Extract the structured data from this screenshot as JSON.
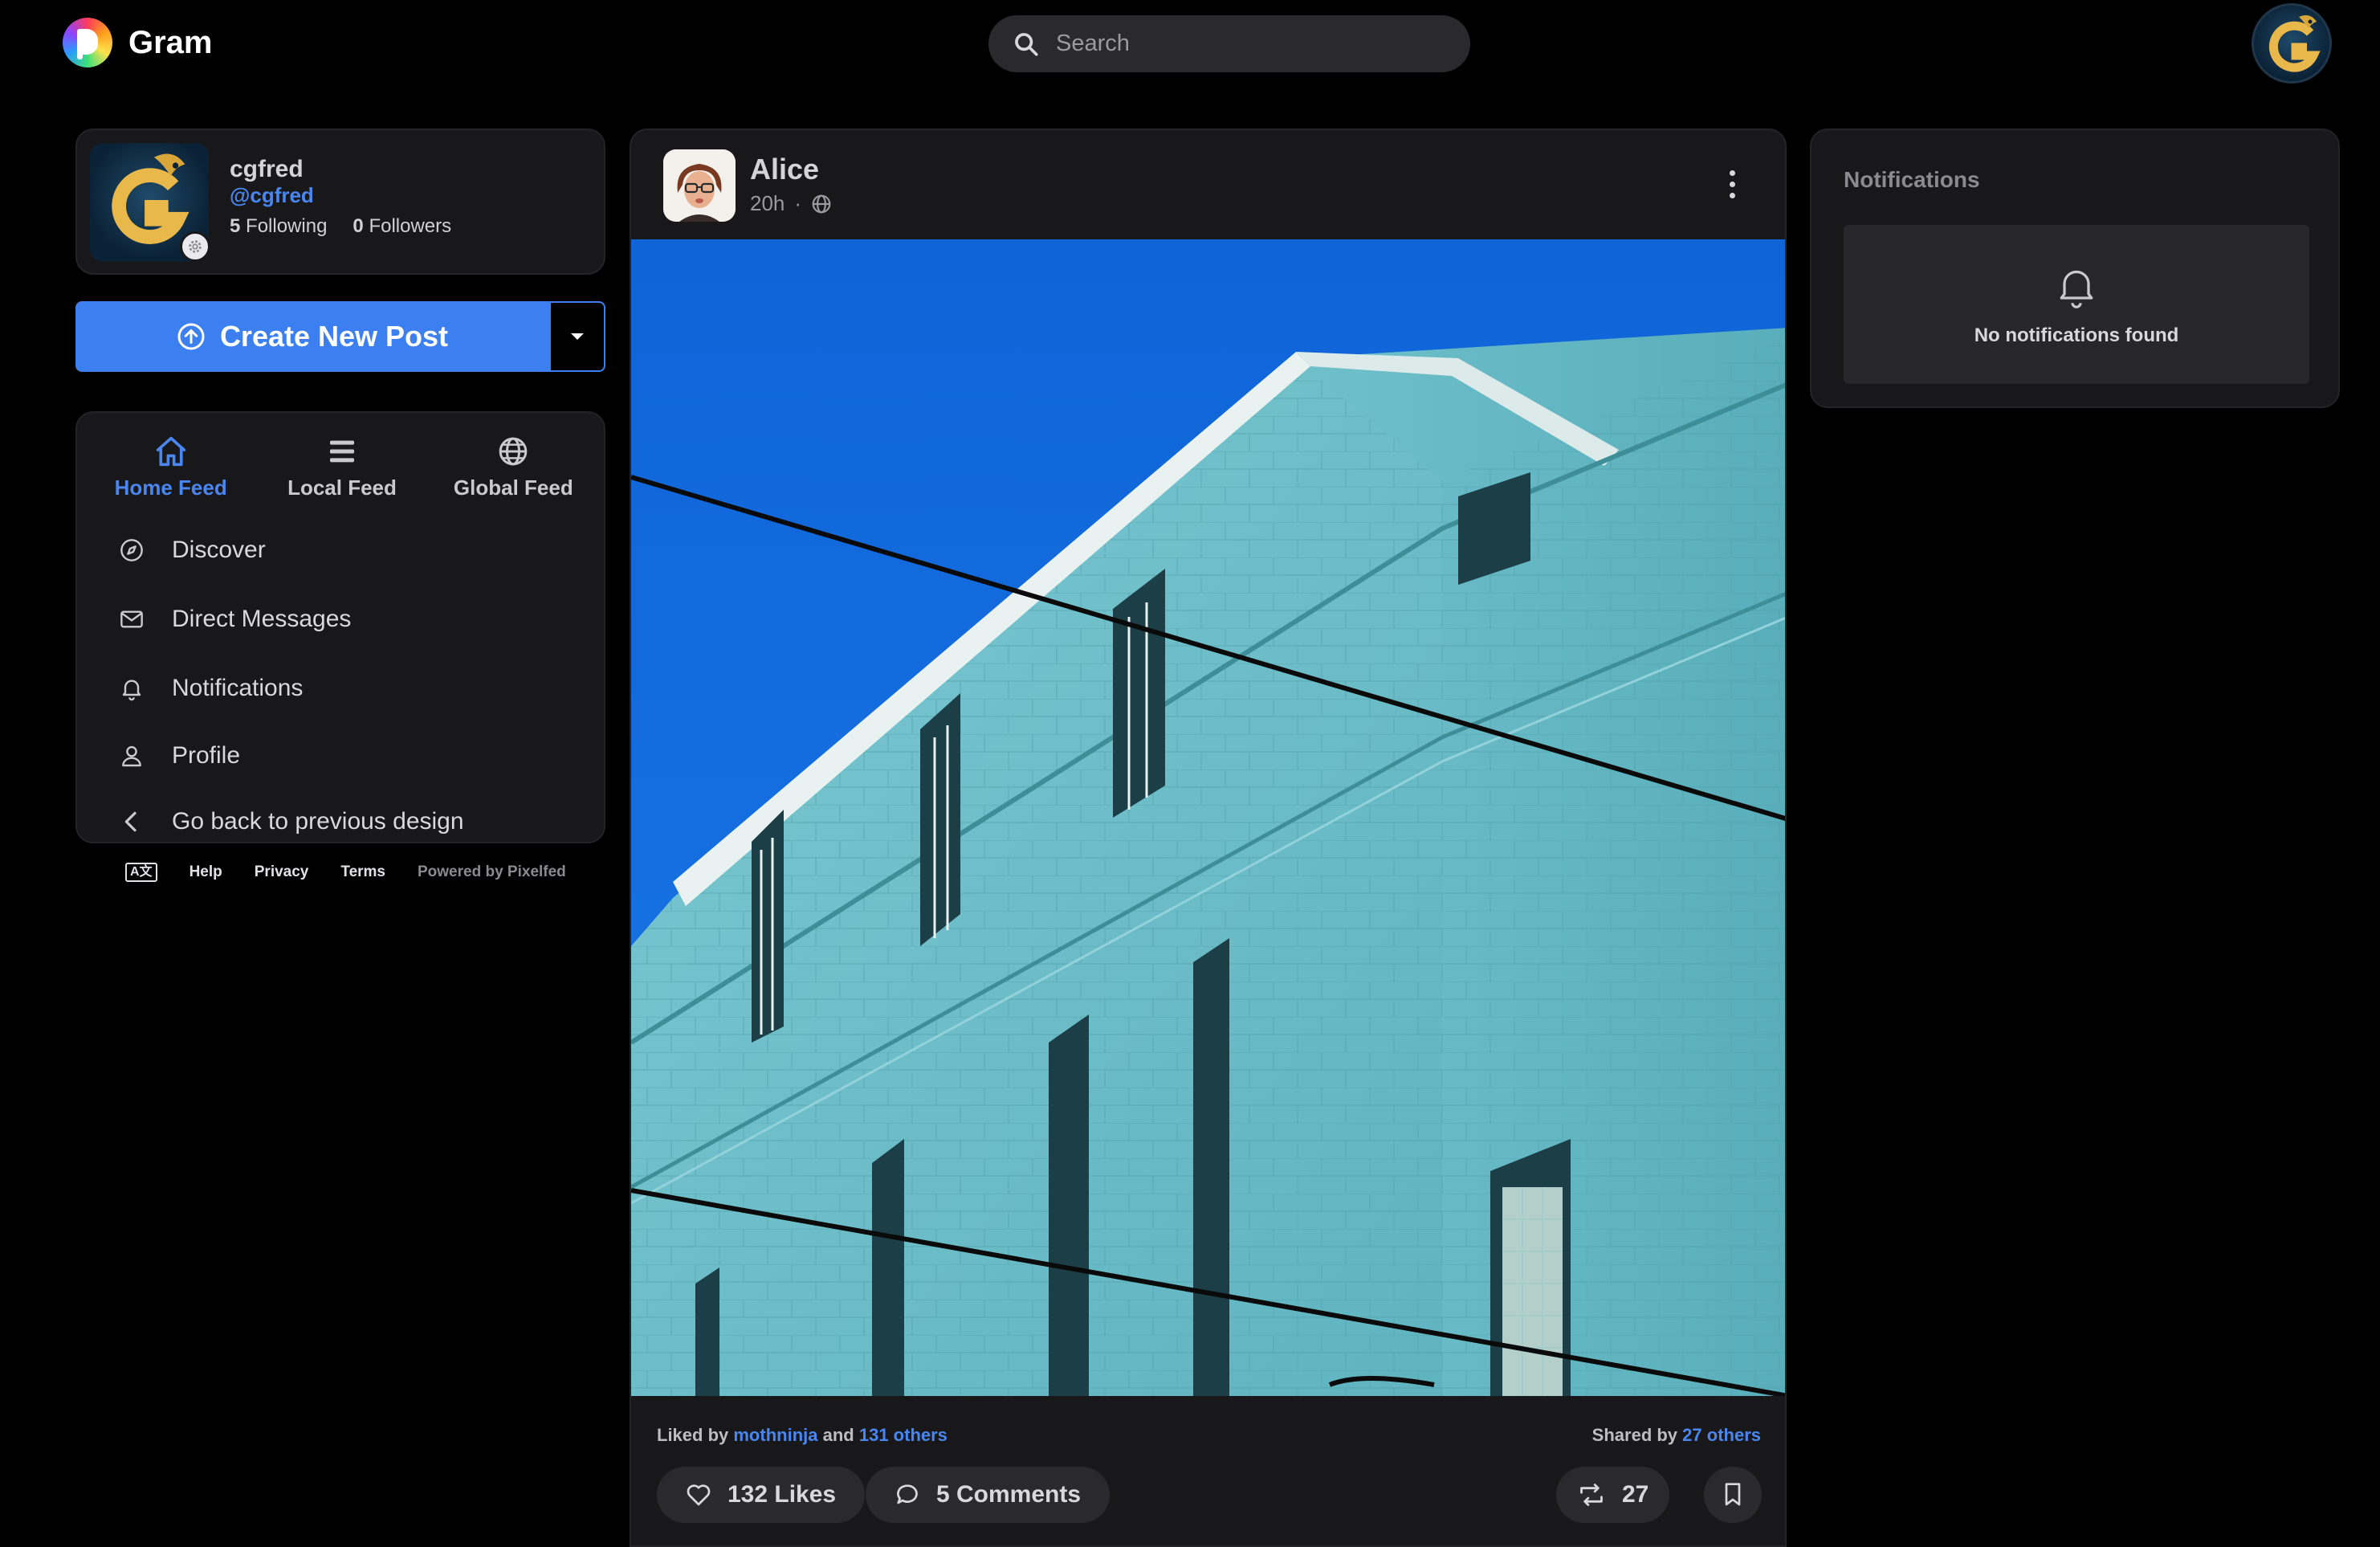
{
  "brand": {
    "name": "Gram"
  },
  "search": {
    "placeholder": "Search"
  },
  "profile": {
    "name": "cgfred",
    "handle": "@cgfred",
    "following_count": "5",
    "following_label": "Following",
    "followers_count": "0",
    "followers_label": "Followers"
  },
  "create_post": {
    "label": "Create New Post"
  },
  "feed_tabs": [
    {
      "label": "Home Feed",
      "icon": "home-icon",
      "active": true
    },
    {
      "label": "Local Feed",
      "icon": "list-icon",
      "active": false
    },
    {
      "label": "Global Feed",
      "icon": "globe-icon",
      "active": false
    }
  ],
  "nav_items": [
    {
      "label": "Discover",
      "icon": "compass-icon"
    },
    {
      "label": "Direct Messages",
      "icon": "envelope-icon"
    },
    {
      "label": "Notifications",
      "icon": "bell-icon"
    },
    {
      "label": "Profile",
      "icon": "user-icon"
    },
    {
      "label": "Go back to previous design",
      "icon": "chevron-left-icon"
    }
  ],
  "footer": {
    "lang_icon": "A文",
    "help": "Help",
    "privacy": "Privacy",
    "terms": "Terms",
    "powered": "Powered by Pixelfed"
  },
  "post": {
    "author": "Alice",
    "time": "20h",
    "visibility_icon": "globe-icon",
    "liked_prefix": "Liked by",
    "liked_user": "mothninja",
    "liked_and": "and",
    "liked_others": "131 others",
    "shared_prefix": "Shared by",
    "shared_others": "27 others",
    "likes_label": "132 Likes",
    "comments_label": "5 Comments",
    "shares_count": "27"
  },
  "notifications": {
    "title": "Notifications",
    "empty_text": "No notifications found"
  },
  "colors": {
    "accent": "#3b7ff0",
    "link": "#4a86f0",
    "card": "#18181b",
    "pill": "#2a2a2e"
  }
}
